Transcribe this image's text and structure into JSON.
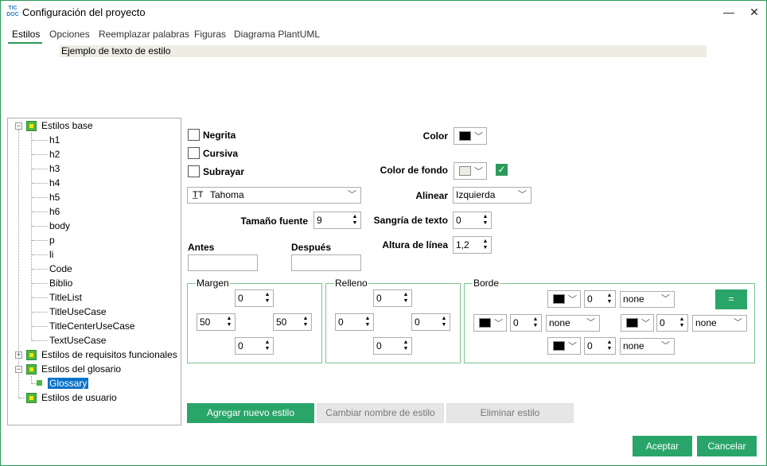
{
  "window": {
    "title": "Configuración del proyecto",
    "icon_text": "TIC DOC",
    "minimize_glyph": "—",
    "close_glyph": "✕"
  },
  "tabs": [
    {
      "label": "Estilos",
      "active": true
    },
    {
      "label": "Opciones"
    },
    {
      "label": "Reemplazar palabras"
    },
    {
      "label": "Figuras"
    },
    {
      "label": "Diagrama PlantUML"
    }
  ],
  "preview": {
    "text": "Ejemplo de texto de estilo"
  },
  "tree": {
    "groups": [
      {
        "label": "Estilos base",
        "expander": "−",
        "children": [
          "h1",
          "h2",
          "h3",
          "h4",
          "h5",
          "h6",
          "body",
          "p",
          "li",
          "Code",
          "Biblio",
          "TitleList",
          "TitleUseCase",
          "TitleCenterUseCase",
          "TextUseCase"
        ]
      },
      {
        "label": "Estilos de requisitos funcionales",
        "expander": "+"
      },
      {
        "label": "Estilos del glosario",
        "expander": "−",
        "children": [
          "Glossary"
        ],
        "selected": "Glossary"
      },
      {
        "label": "Estilos de usuario"
      }
    ]
  },
  "style": {
    "bold_label": "Negrita",
    "italic_label": "Cursiva",
    "underline_label": "Subrayar",
    "font": {
      "icon": "font-icon",
      "glyph": "T̲T",
      "value": "Tahoma"
    },
    "font_size_label": "Tamaño fuente",
    "font_size": "9",
    "before_label": "Antes",
    "after_label": "Después",
    "color_label": "Color",
    "color_value": "#000000",
    "bgcolor_label": "Color de fondo",
    "bgcolor_value": "#eeede4",
    "bgcolor_enabled": true,
    "align_label": "Alinear",
    "align_value": "Izquierda",
    "indent_label": "Sangría de texto",
    "indent_value": "0",
    "line_height_label": "Altura de línea",
    "line_height_value": "1,2"
  },
  "margin": {
    "title": "Margen",
    "top": "0",
    "left": "50",
    "right": "50",
    "bottom": "0"
  },
  "padding": {
    "title": "Relleno",
    "top": "0",
    "left": "0",
    "right": "0",
    "bottom": "0"
  },
  "border": {
    "title": "Borde",
    "equal_label": "=",
    "top": {
      "color": "#000000",
      "width": "0",
      "style": "none"
    },
    "left": {
      "color": "#000000",
      "width": "0",
      "style": "none"
    },
    "right": {
      "color": "#000000",
      "width": "0",
      "style": "none"
    },
    "bottom": {
      "color": "#000000",
      "width": "0",
      "style": "none"
    }
  },
  "actions": {
    "add_style": "Agregar nuevo estilo",
    "rename_style": "Cambiar nombre de estilo",
    "delete_style": "Eliminar estilo"
  },
  "footer": {
    "accept": "Aceptar",
    "cancel": "Cancelar"
  }
}
